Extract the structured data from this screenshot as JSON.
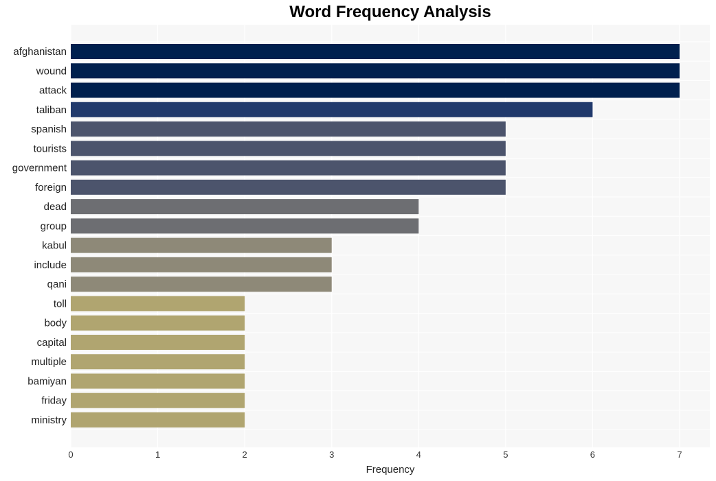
{
  "chart_data": {
    "type": "bar",
    "orientation": "horizontal",
    "title": "Word Frequency Analysis",
    "xlabel": "Frequency",
    "ylabel": "",
    "xlim": [
      0,
      7.35
    ],
    "xticks": [
      0,
      1,
      2,
      3,
      4,
      5,
      6,
      7
    ],
    "grid": true,
    "legend": "none",
    "categories": [
      "afghanistan",
      "wound",
      "attack",
      "taliban",
      "spanish",
      "tourists",
      "government",
      "foreign",
      "dead",
      "group",
      "kabul",
      "include",
      "qani",
      "toll",
      "body",
      "capital",
      "multiple",
      "bamiyan",
      "friday",
      "ministry"
    ],
    "values": [
      7,
      7,
      7,
      6,
      5,
      5,
      5,
      5,
      4,
      4,
      3,
      3,
      3,
      2,
      2,
      2,
      2,
      2,
      2,
      2
    ],
    "colors_by_value": {
      "7": "#00204e",
      "6": "#213a6c",
      "5": "#4c546c",
      "4": "#6d6e72",
      "3": "#8e8978",
      "2": "#b0a570"
    },
    "background": "#f7f7f7"
  }
}
